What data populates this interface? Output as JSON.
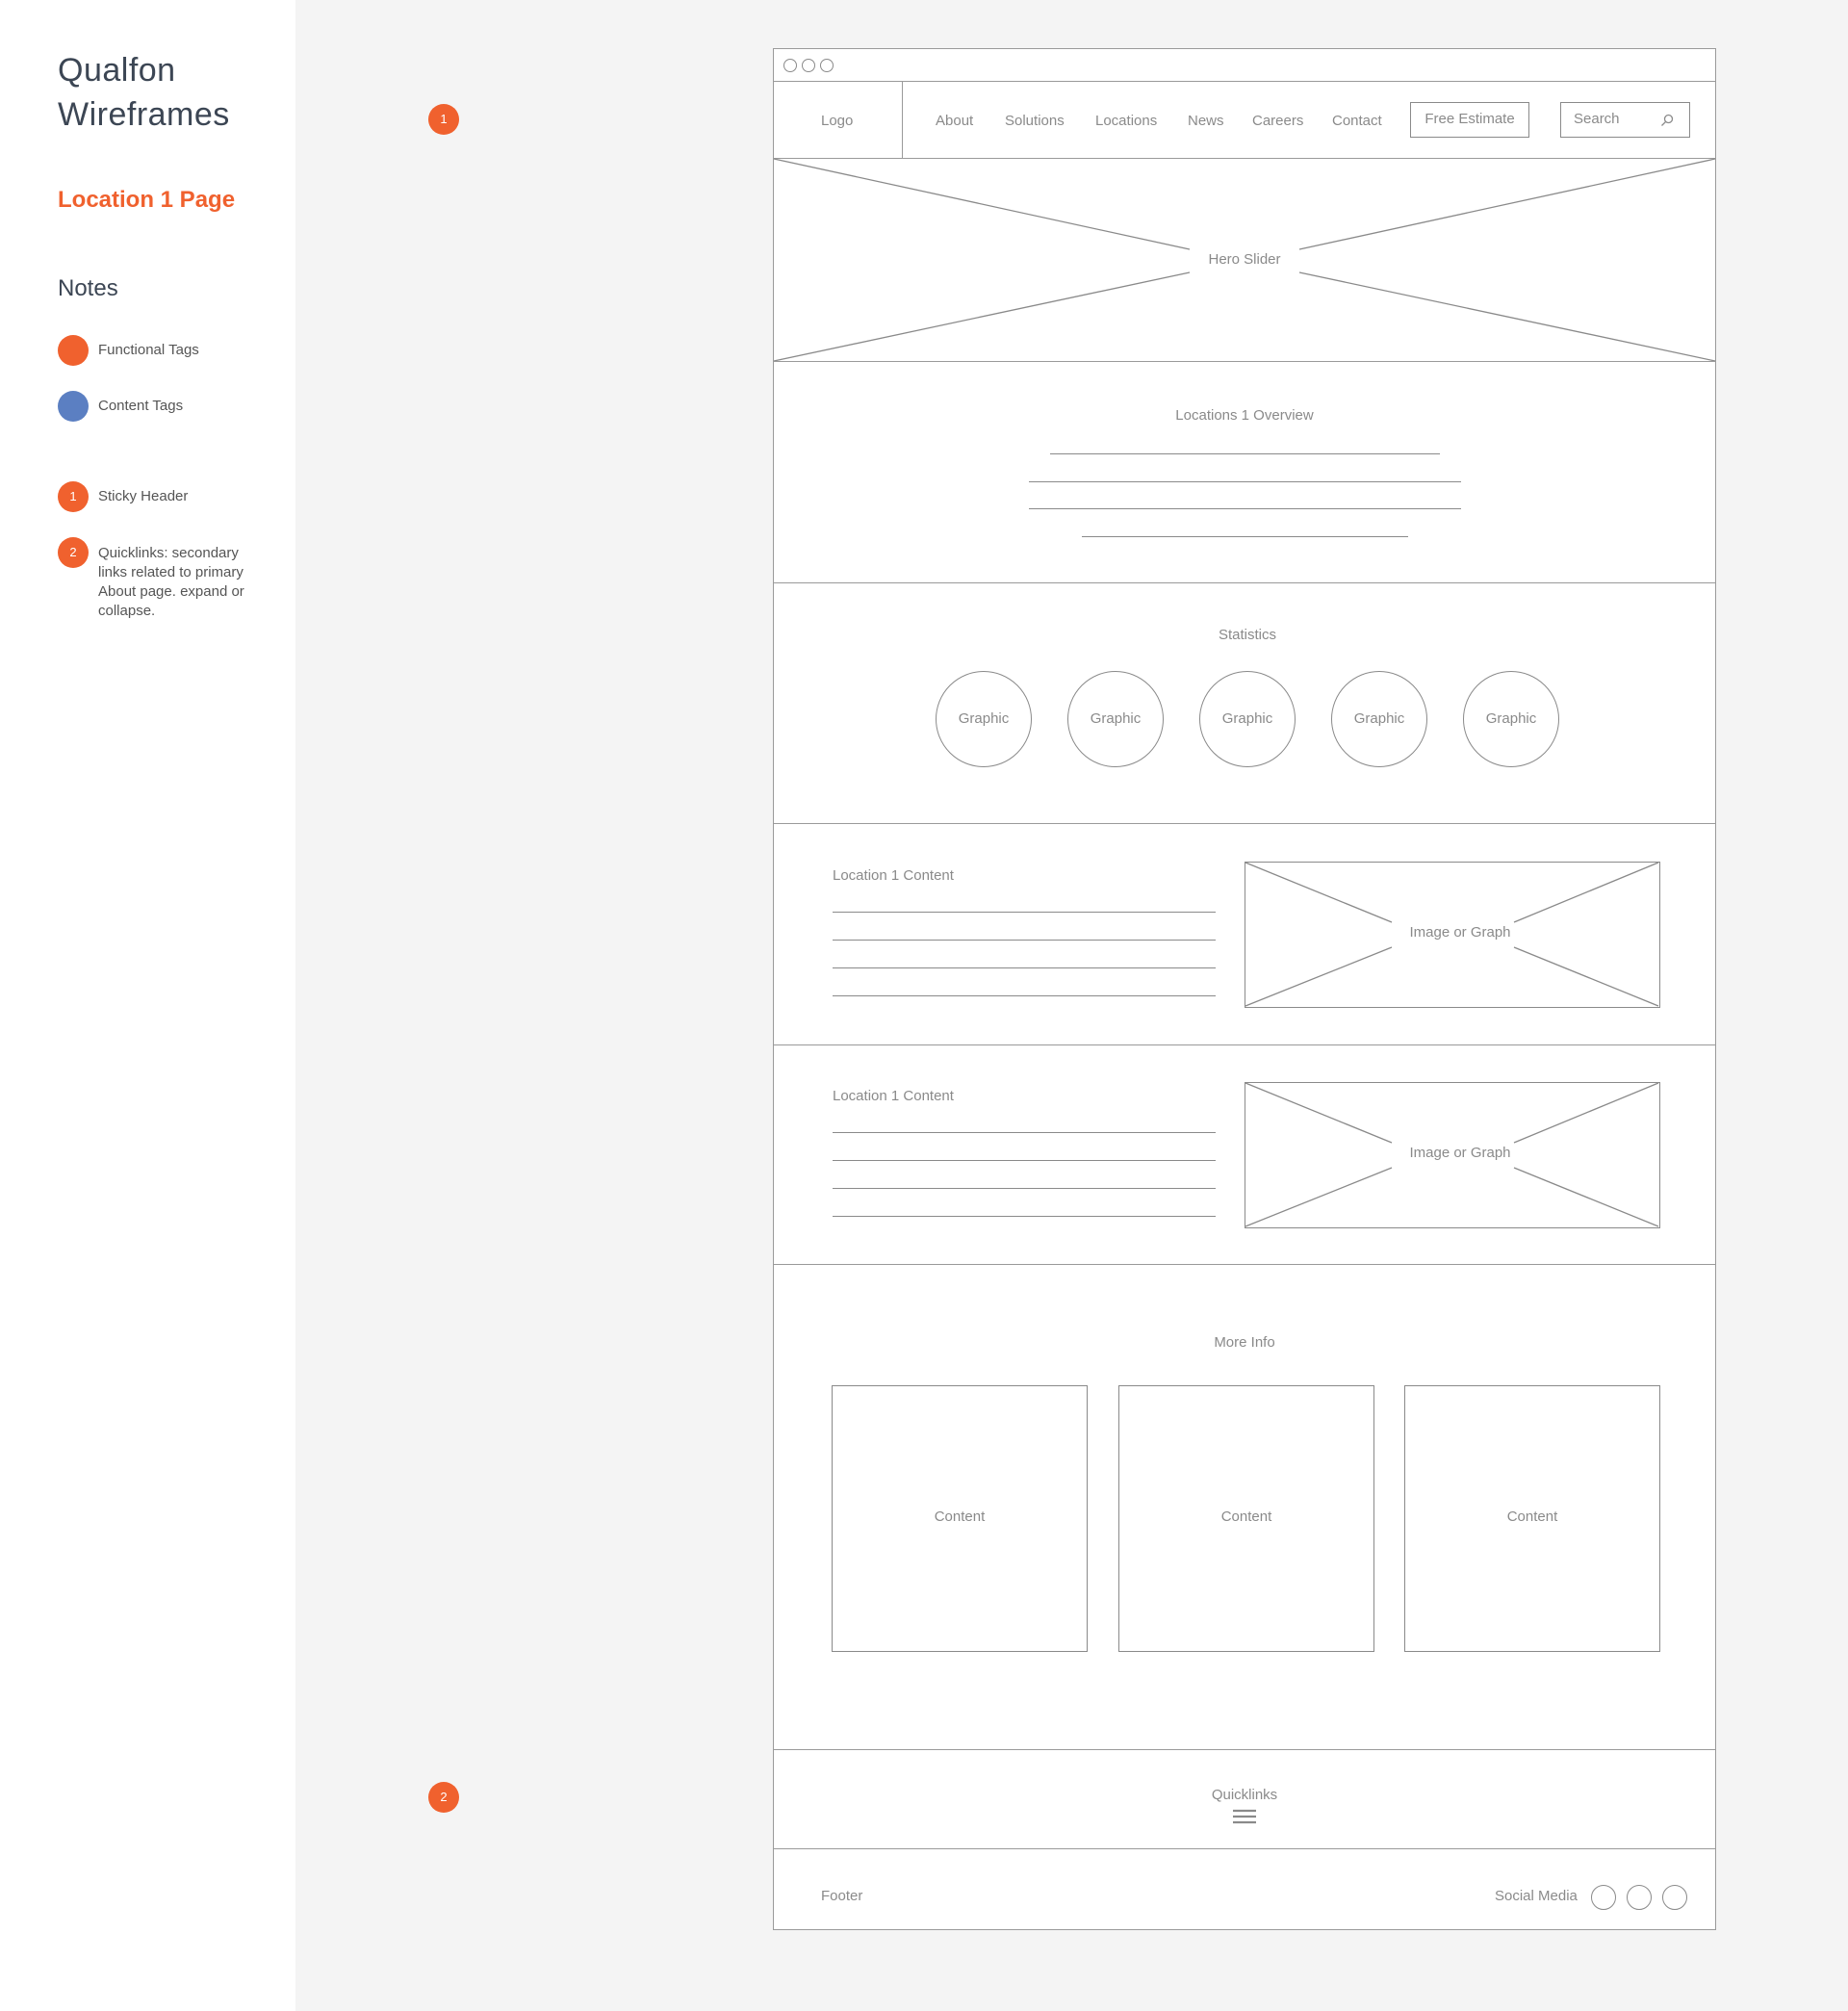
{
  "sidebar": {
    "project_title_line1": "Qualfon",
    "project_title_line2": "Wireframes",
    "page_name": "Location 1 Page",
    "notes_heading": "Notes",
    "legend": [
      {
        "label": "Functional Tags",
        "color": "#f0612e"
      },
      {
        "label": "Content Tags",
        "color": "#5b7fc2"
      }
    ],
    "annotations": [
      {
        "number": "1",
        "text": "Sticky Header"
      },
      {
        "number": "2",
        "text_lines": [
          "Quicklinks: secondary",
          "links related to primary",
          "About page. expand or",
          "collapse."
        ]
      }
    ]
  },
  "header": {
    "logo": "Logo",
    "nav": [
      "About",
      "Solutions",
      "Locations",
      "News",
      "Careers",
      "Contact"
    ],
    "cta_button": "Free Estimate",
    "search_placeholder": "Search",
    "tag_number": "1"
  },
  "hero": {
    "label": "Hero Slider"
  },
  "overview": {
    "title": "Locations 1 Overview"
  },
  "statistics": {
    "title": "Statistics",
    "items": [
      "Graphic",
      "Graphic",
      "Graphic",
      "Graphic",
      "Graphic"
    ]
  },
  "content_sections": [
    {
      "title": "Location 1 Content",
      "media_label": "Image or Graph"
    },
    {
      "title": "Location 1 Content",
      "media_label": "Image or Graph"
    }
  ],
  "more_info": {
    "title": "More Info",
    "cards": [
      "Content",
      "Content",
      "Content"
    ]
  },
  "quicklinks": {
    "label": "Quicklinks",
    "tag_number": "2"
  },
  "footer": {
    "label": "Footer",
    "social_label": "Social Media"
  },
  "colors": {
    "accent": "#f0612e",
    "content_tag": "#5b7fc2",
    "wire": "#8a8a8a",
    "canvas": "#f4f4f4"
  }
}
